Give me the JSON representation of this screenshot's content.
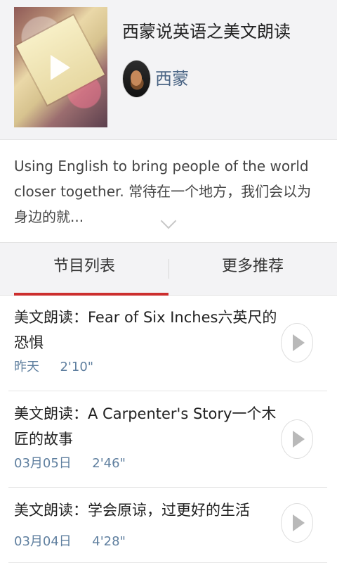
{
  "podcast": {
    "title": "西蒙说英语之美文朗读",
    "author": "西蒙",
    "description": "Using English to bring people of the world closer together. 常待在一个地方，我们会以为身边的就..."
  },
  "tabs": {
    "left": "节目列表",
    "right": "更多推荐"
  },
  "episodes": [
    {
      "title": "美文朗读：Fear of Six Inches六英尺的恐惧",
      "date": "昨天",
      "duration": "2'10\""
    },
    {
      "title": "美文朗读：A Carpenter's Story一个木匠的故事",
      "date": "03月05日",
      "duration": "2'46\""
    },
    {
      "title": "美文朗读：学会原谅，过更好的生活",
      "date": "03月04日",
      "duration": "4'28\""
    }
  ],
  "icons": {
    "cover_play": "play-icon",
    "expand": "chevron-down-icon",
    "episode_play": "play-icon"
  },
  "colors": {
    "accent": "#cc2e2e",
    "author": "#4a6484",
    "meta": "#5f7f9f"
  }
}
